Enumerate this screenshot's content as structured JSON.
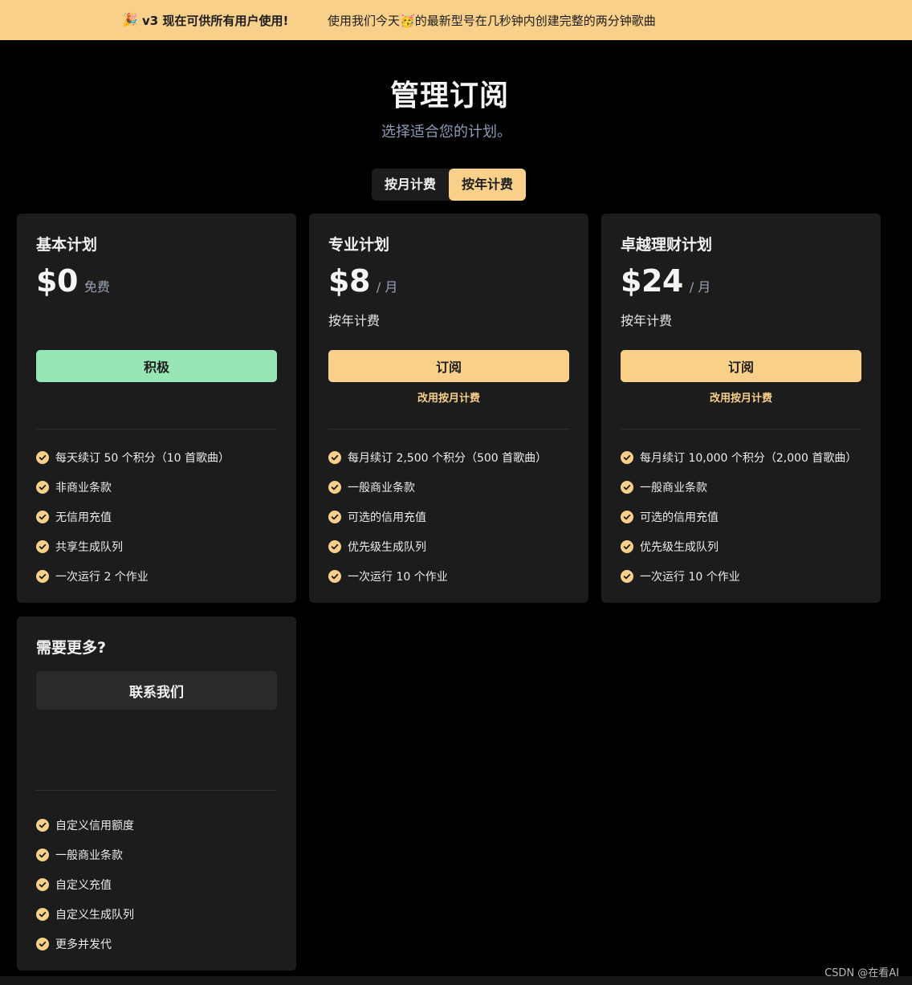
{
  "banner": {
    "party_emoji": "🎉",
    "headline": "v3 现在可供所有用户使用!",
    "message_before": "使用我们今天",
    "message_emoji": "🥳",
    "message_after": "的最新型号在几秒钟内创建完整的两分钟歌曲"
  },
  "header": {
    "title": "管理订阅",
    "subtitle": "选择适合您的计划。"
  },
  "billing_toggle": {
    "monthly_label": "按月计费",
    "yearly_label": "按年计费",
    "selected": "yearly"
  },
  "plans": [
    {
      "name": "基本计划",
      "price": "$0",
      "unit": "免费",
      "billing_note": "",
      "button_label": "积极",
      "switch_label": "",
      "features": [
        "每天续订 50 个积分（10 首歌曲）",
        "非商业条款",
        "无信用充值",
        "共享生成队列",
        "一次运行 2 个作业"
      ]
    },
    {
      "name": "专业计划",
      "price": "$8",
      "unit": "/ 月",
      "billing_note": "按年计费",
      "button_label": "订阅",
      "switch_label": "改用按月计费",
      "features": [
        "每月续订 2,500 个积分（500 首歌曲）",
        "一般商业条款",
        "可选的信用充值",
        "优先级生成队列",
        "一次运行 10 个作业"
      ]
    },
    {
      "name": "卓越理财计划",
      "price": "$24",
      "unit": "/ 月",
      "billing_note": "按年计费",
      "button_label": "订阅",
      "switch_label": "改用按月计费",
      "features": [
        "每月续订 10,000 个积分（2,000 首歌曲）",
        "一般商业条款",
        "可选的信用充值",
        "优先级生成队列",
        "一次运行 10 个作业"
      ]
    }
  ],
  "enterprise": {
    "name": "需要更多?",
    "button_label": "联系我们",
    "features": [
      "自定义信用额度",
      "一般商业条款",
      "自定义充值",
      "自定义生成队列",
      "更多并发代"
    ]
  },
  "watermark": "CSDN @在看AI",
  "colors": {
    "accent": "#f9d089",
    "active_green": "#98e6b5",
    "card_bg": "#1c1c1c",
    "page_bg": "#000000"
  },
  "icons": {
    "feature_check": "check-circle-icon"
  }
}
